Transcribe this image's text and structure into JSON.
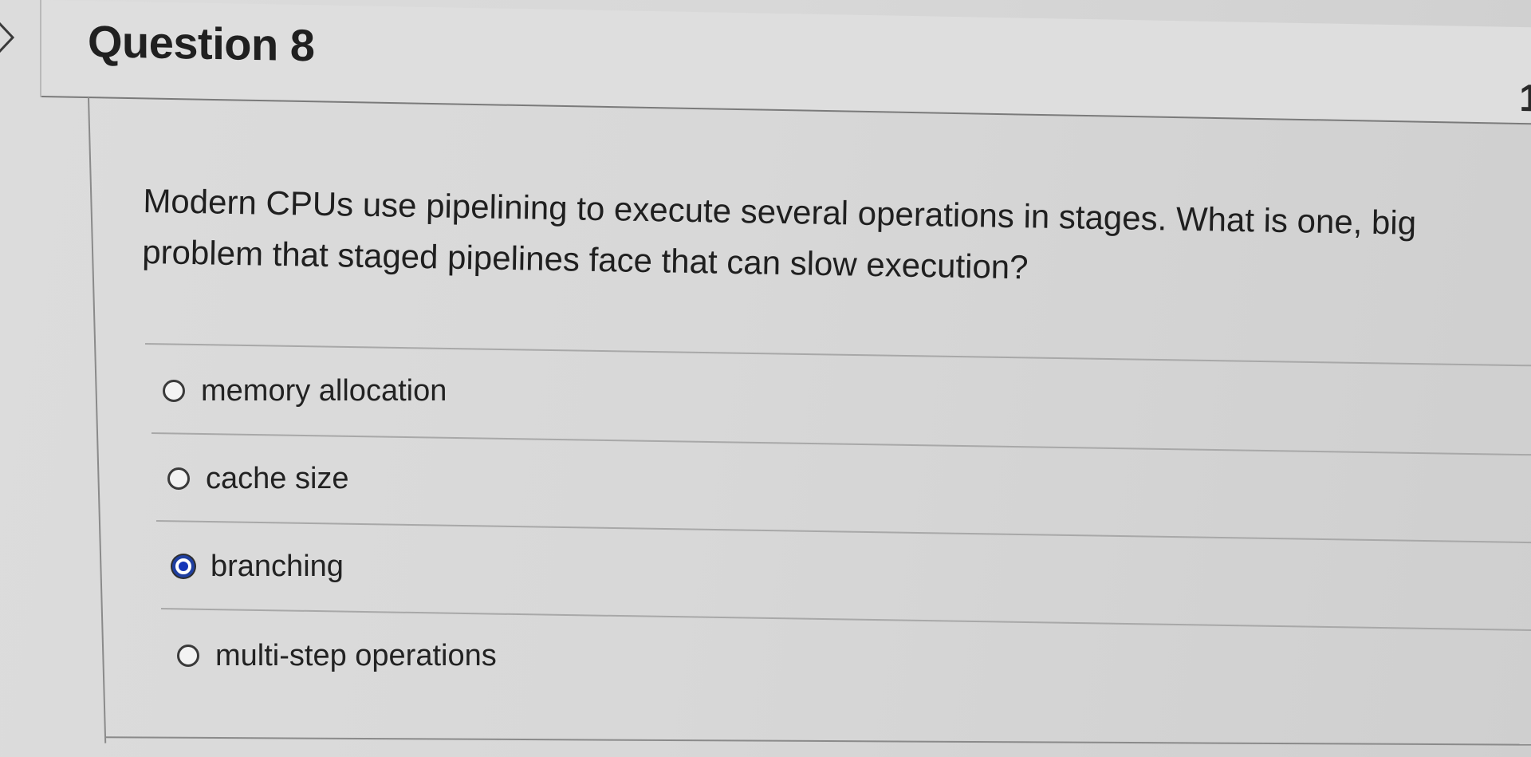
{
  "question": {
    "title": "Question 8",
    "points": "1",
    "text": "Modern CPUs use pipelining to execute several operations in stages.  What is one, big problem that staged pipelines face that can slow execution?"
  },
  "answers": [
    {
      "label": "memory allocation",
      "selected": false
    },
    {
      "label": "cache size",
      "selected": false
    },
    {
      "label": "branching",
      "selected": true
    },
    {
      "label": "multi-step operations",
      "selected": false
    }
  ],
  "icons": {
    "nav": "chevron-right-icon"
  }
}
